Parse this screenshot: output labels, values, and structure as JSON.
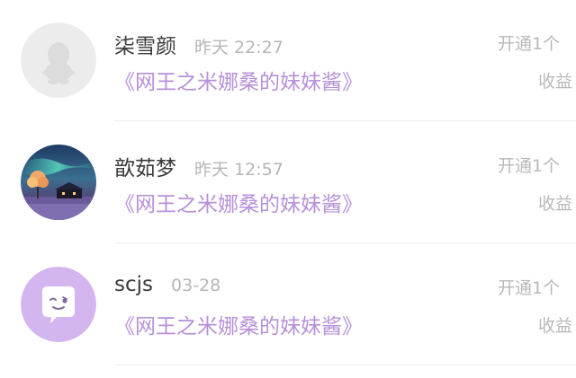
{
  "rows": [
    {
      "name": "柒雪颜",
      "time": "昨天 22:27",
      "book": "《网王之米娜桑的妹妹酱》",
      "action": "开通1个",
      "earnings": "收益",
      "avatar": "default-penguin-avatar"
    },
    {
      "name": "歆茹梦",
      "time": "昨天 12:57",
      "book": "《网王之米娜桑的妹妹酱》",
      "action": "开通1个",
      "earnings": "收益",
      "avatar": "night-sky-tree-avatar"
    },
    {
      "name": "scjs",
      "time": "03-28",
      "book": "《网王之米娜桑的妹妹酱》",
      "action": "开通1个",
      "earnings": "收益",
      "avatar": "purple-chat-bubble-avatar"
    }
  ],
  "colors": {
    "name": "#3a3a3a",
    "time": "#b6b6b6",
    "book_link": "#b690d9",
    "right_text": "#b9b9b9",
    "avatar_purple": "#d3b6f0"
  }
}
